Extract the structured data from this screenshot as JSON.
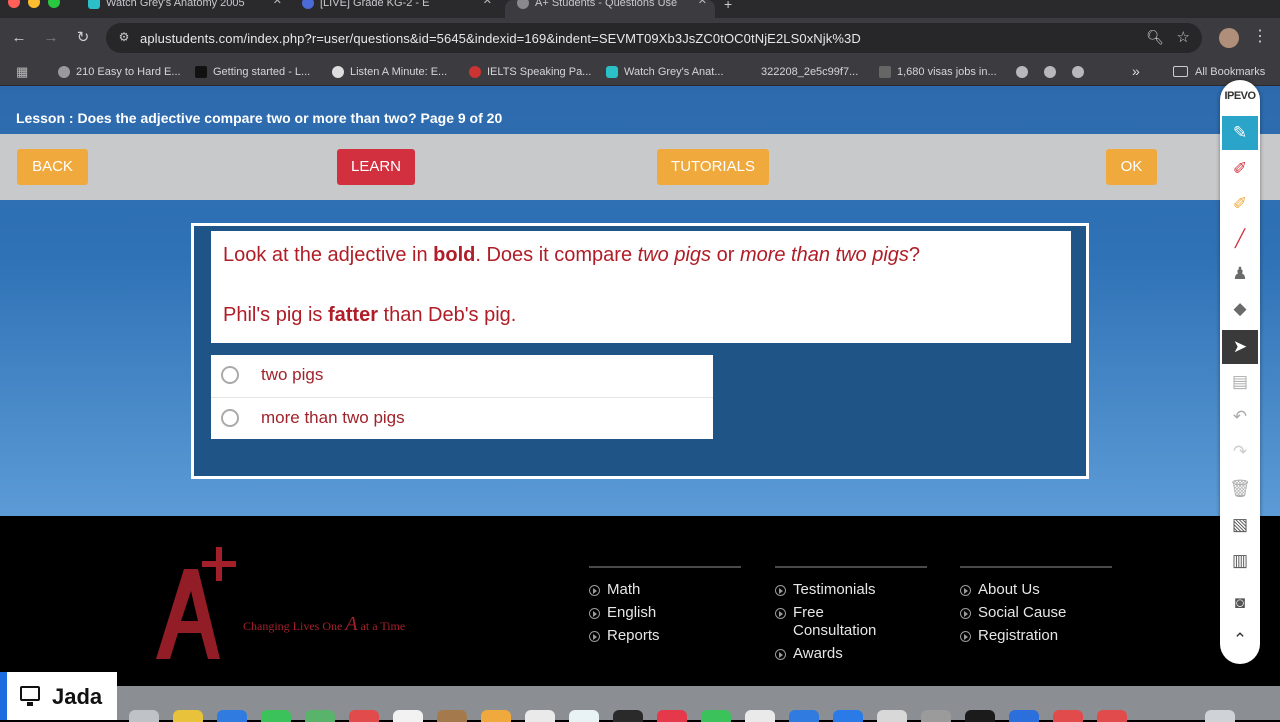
{
  "browser": {
    "tabs": [
      {
        "title": "Watch Grey's Anatomy 2005"
      },
      {
        "title": "[LIVE] Grade KG-2 - E"
      },
      {
        "title": "A+ Students - Questions Use"
      }
    ],
    "url": "aplustudents.com/index.php?r=user/questions&id=5645&indexid=169&indent=SEVMT09Xb3JsZC0tOC0tNjE2LS0xNjk%3D",
    "bookmarks": [
      {
        "label": "210 Easy to Hard E..."
      },
      {
        "label": "Getting started - L..."
      },
      {
        "label": "Listen A Minute: E..."
      },
      {
        "label": "IELTS Speaking Pa..."
      },
      {
        "label": "Watch Grey's Anat..."
      },
      {
        "label": "322208_2e5c99f7..."
      },
      {
        "label": "1,680 visas jobs in..."
      }
    ],
    "bookmarks_more": "»",
    "all_bookmarks": "All Bookmarks"
  },
  "lesson": {
    "title": "Lesson : Does the adjective compare two or more than two? Page 9 of 20",
    "buttons": {
      "back": "BACK",
      "learn": "LEARN",
      "tutorials": "TUTORIALS",
      "ok": "OK"
    }
  },
  "question": {
    "l1_a": "Look at the adjective in ",
    "l1_b": "bold",
    "l1_c": ". Does it compare ",
    "l1_d": "two pigs",
    "l1_e": " or ",
    "l1_f": "more than two pigs",
    "l1_g": "?",
    "l2_a": "Phil's pig is ",
    "l2_b": "fatter",
    "l2_c": " than Deb's pig."
  },
  "answers": [
    {
      "label": "two pigs",
      "selected": false
    },
    {
      "label": "more than two pigs",
      "selected": false
    }
  ],
  "footer": {
    "tagline_a": "Changing Lives One ",
    "tagline_b": "A",
    "tagline_c": " at a Time",
    "col1": [
      "Math",
      "English",
      "Reports"
    ],
    "col2_a": "Testimonials",
    "col2_b": "Free",
    "col2_c": "Consultation",
    "col2_d": "Awards",
    "col3": [
      "About Us",
      "Social Cause",
      "Registration"
    ]
  },
  "presenter": {
    "name": "Jada"
  },
  "ipevo": {
    "brand": "IPEVO"
  },
  "colors": {
    "accent_orange": "#f0a93c",
    "accent_red": "#d3303f",
    "quiz_bg": "#1f5586",
    "question_text": "#b01d27"
  }
}
